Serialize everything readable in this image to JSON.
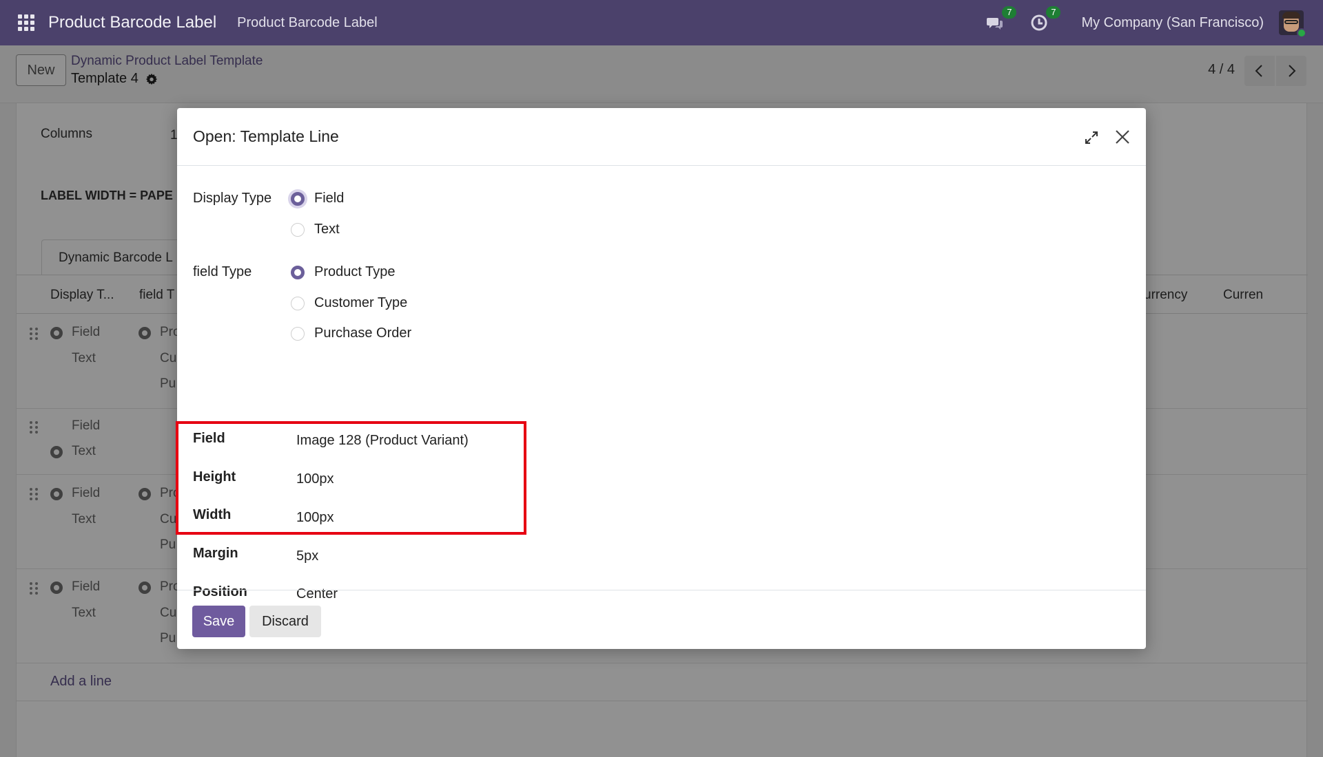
{
  "navbar": {
    "app_title": "Product Barcode Label",
    "menu_item": "Product Barcode Label",
    "messages_count": "7",
    "activities_count": "7",
    "company": "My Company (San Francisco)"
  },
  "control": {
    "new_label": "New",
    "breadcrumb_parent": "Dynamic Product Label Template",
    "breadcrumb_current": "Template 4",
    "pager": "4 / 4"
  },
  "sheet": {
    "columns_label": "Columns",
    "columns_value": "1",
    "label_width_note": "LABEL WIDTH = PAPE",
    "tab_label": "Dynamic Barcode L",
    "headers": {
      "display_type": "Display T...",
      "field_type": "field T",
      "currency": "urrency",
      "curren": "Curren"
    },
    "row_texts": {
      "field": "Field",
      "text": "Text",
      "pro": "Pro",
      "cu": "Cu",
      "pu": "Pu"
    },
    "add_line": "Add a line"
  },
  "modal": {
    "title": "Open: Template Line",
    "display_type": {
      "label": "Display Type",
      "options": [
        "Field",
        "Text"
      ],
      "selected": "Field"
    },
    "field_type": {
      "label": "field Type",
      "options": [
        "Product Type",
        "Customer Type",
        "Purchase Order"
      ],
      "selected": "Product Type"
    },
    "fields": [
      {
        "label": "Field",
        "value": "Image 128 (Product Variant)"
      },
      {
        "label": "Height",
        "value": "100px"
      },
      {
        "label": "Width",
        "value": "100px"
      },
      {
        "label": "Margin",
        "value": "5px"
      },
      {
        "label": "Position",
        "value": "Center"
      }
    ],
    "save_label": "Save",
    "discard_label": "Discard"
  },
  "colors": {
    "navbar_bg": "#4b416b",
    "primary": "#6f5b9e",
    "badge": "#1e7e34",
    "highlight_box": "#e60012"
  }
}
